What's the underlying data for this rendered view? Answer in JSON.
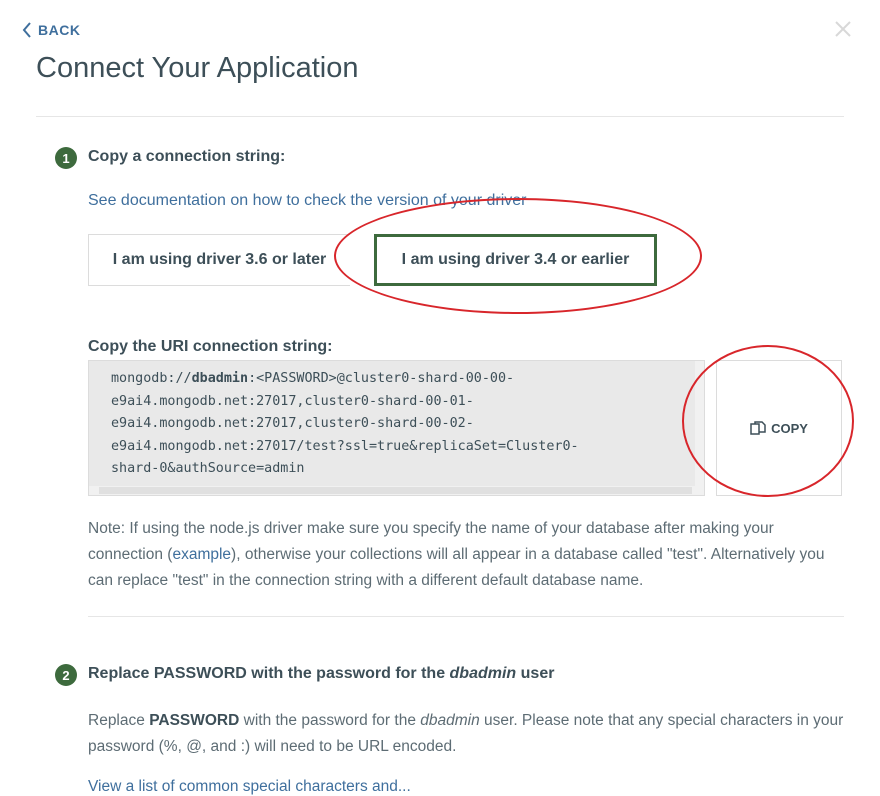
{
  "nav": {
    "back_label": "BACK",
    "close_icon": "close-icon"
  },
  "page": {
    "title": "Connect Your Application"
  },
  "step1": {
    "number": "1",
    "title": "Copy a connection string:",
    "doc_link": "See documentation on how to check the version of your driver",
    "driver_options": [
      "I am using driver 3.6 or later",
      "I am using driver 3.4 or earlier"
    ],
    "selected_driver": "I am using driver 3.4 or earlier",
    "uri_label": "Copy the URI connection string:",
    "uri": {
      "prefix": "mongodb://",
      "user": "dbadmin",
      "password_placeholder": ":<PASSWORD>",
      "line1_rest": "@cluster0-shard-00-00-",
      "line2": "e9ai4.mongodb.net:27017,cluster0-shard-00-01-",
      "line3": "e9ai4.mongodb.net:27017,cluster0-shard-00-02-",
      "line4": "e9ai4.mongodb.net:27017/test?ssl=true&replicaSet=Cluster0-",
      "line5": "shard-0&authSource=admin"
    },
    "copy_label": "COPY",
    "note": {
      "part1": "Note: If using the node.js driver make sure you specify the name of your database after making your connection (",
      "link": "example",
      "part2": "), otherwise your collections will all appear in a database called \"test\". Alternatively you can replace \"test\" in the connection string with a different default database name."
    }
  },
  "step2": {
    "number": "2",
    "title_pre": "Replace PASSWORD with the password for the ",
    "title_user": "dbadmin",
    "title_post": " user",
    "body_pre": "Replace ",
    "body_bold": "PASSWORD",
    "body_mid": " with the password for the ",
    "body_user": "dbadmin",
    "body_post": " user. Please note that any special characters in your password (%, @, and :) will need to be URL encoded.",
    "cutoff_link": "View a list of common special characters and..."
  },
  "colors": {
    "accent_green": "#3d6a3d",
    "link_blue": "#3f6f9d",
    "annotation_red": "#d8262b"
  }
}
